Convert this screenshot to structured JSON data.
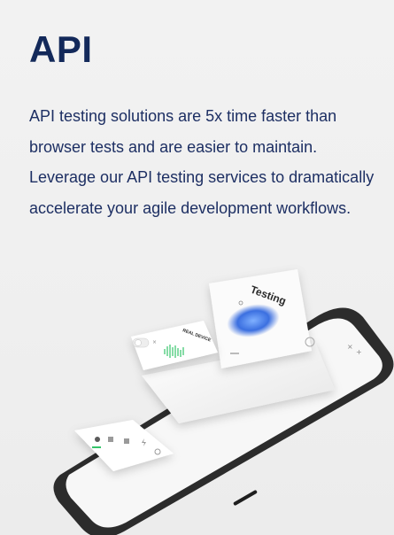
{
  "section": {
    "title": "API",
    "description": "API testing solutions are 5x time faster than browser tests and are easier to maintain. Leverage our API testing services to dramatically accelerate your agile development workflows."
  },
  "illustration": {
    "screen_title": "Testing",
    "badge_text": "REAL DEVICE",
    "accent_color": "#3b6fe0",
    "green_color": "#35c46a",
    "phone_color": "#2c2c2c",
    "text_color": "#13295a"
  }
}
